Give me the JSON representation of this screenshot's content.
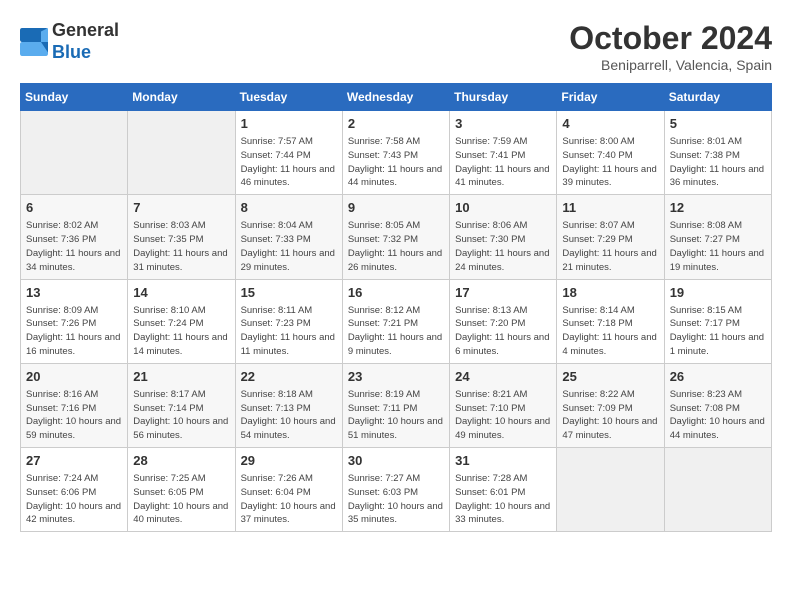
{
  "logo": {
    "text_general": "General",
    "text_blue": "Blue"
  },
  "header": {
    "month": "October 2024",
    "location": "Beniparrell, Valencia, Spain"
  },
  "days_of_week": [
    "Sunday",
    "Monday",
    "Tuesday",
    "Wednesday",
    "Thursday",
    "Friday",
    "Saturday"
  ],
  "weeks": [
    [
      {
        "day": null
      },
      {
        "day": null
      },
      {
        "day": "1",
        "sunrise": "Sunrise: 7:57 AM",
        "sunset": "Sunset: 7:44 PM",
        "daylight": "Daylight: 11 hours and 46 minutes."
      },
      {
        "day": "2",
        "sunrise": "Sunrise: 7:58 AM",
        "sunset": "Sunset: 7:43 PM",
        "daylight": "Daylight: 11 hours and 44 minutes."
      },
      {
        "day": "3",
        "sunrise": "Sunrise: 7:59 AM",
        "sunset": "Sunset: 7:41 PM",
        "daylight": "Daylight: 11 hours and 41 minutes."
      },
      {
        "day": "4",
        "sunrise": "Sunrise: 8:00 AM",
        "sunset": "Sunset: 7:40 PM",
        "daylight": "Daylight: 11 hours and 39 minutes."
      },
      {
        "day": "5",
        "sunrise": "Sunrise: 8:01 AM",
        "sunset": "Sunset: 7:38 PM",
        "daylight": "Daylight: 11 hours and 36 minutes."
      }
    ],
    [
      {
        "day": "6",
        "sunrise": "Sunrise: 8:02 AM",
        "sunset": "Sunset: 7:36 PM",
        "daylight": "Daylight: 11 hours and 34 minutes."
      },
      {
        "day": "7",
        "sunrise": "Sunrise: 8:03 AM",
        "sunset": "Sunset: 7:35 PM",
        "daylight": "Daylight: 11 hours and 31 minutes."
      },
      {
        "day": "8",
        "sunrise": "Sunrise: 8:04 AM",
        "sunset": "Sunset: 7:33 PM",
        "daylight": "Daylight: 11 hours and 29 minutes."
      },
      {
        "day": "9",
        "sunrise": "Sunrise: 8:05 AM",
        "sunset": "Sunset: 7:32 PM",
        "daylight": "Daylight: 11 hours and 26 minutes."
      },
      {
        "day": "10",
        "sunrise": "Sunrise: 8:06 AM",
        "sunset": "Sunset: 7:30 PM",
        "daylight": "Daylight: 11 hours and 24 minutes."
      },
      {
        "day": "11",
        "sunrise": "Sunrise: 8:07 AM",
        "sunset": "Sunset: 7:29 PM",
        "daylight": "Daylight: 11 hours and 21 minutes."
      },
      {
        "day": "12",
        "sunrise": "Sunrise: 8:08 AM",
        "sunset": "Sunset: 7:27 PM",
        "daylight": "Daylight: 11 hours and 19 minutes."
      }
    ],
    [
      {
        "day": "13",
        "sunrise": "Sunrise: 8:09 AM",
        "sunset": "Sunset: 7:26 PM",
        "daylight": "Daylight: 11 hours and 16 minutes."
      },
      {
        "day": "14",
        "sunrise": "Sunrise: 8:10 AM",
        "sunset": "Sunset: 7:24 PM",
        "daylight": "Daylight: 11 hours and 14 minutes."
      },
      {
        "day": "15",
        "sunrise": "Sunrise: 8:11 AM",
        "sunset": "Sunset: 7:23 PM",
        "daylight": "Daylight: 11 hours and 11 minutes."
      },
      {
        "day": "16",
        "sunrise": "Sunrise: 8:12 AM",
        "sunset": "Sunset: 7:21 PM",
        "daylight": "Daylight: 11 hours and 9 minutes."
      },
      {
        "day": "17",
        "sunrise": "Sunrise: 8:13 AM",
        "sunset": "Sunset: 7:20 PM",
        "daylight": "Daylight: 11 hours and 6 minutes."
      },
      {
        "day": "18",
        "sunrise": "Sunrise: 8:14 AM",
        "sunset": "Sunset: 7:18 PM",
        "daylight": "Daylight: 11 hours and 4 minutes."
      },
      {
        "day": "19",
        "sunrise": "Sunrise: 8:15 AM",
        "sunset": "Sunset: 7:17 PM",
        "daylight": "Daylight: 11 hours and 1 minute."
      }
    ],
    [
      {
        "day": "20",
        "sunrise": "Sunrise: 8:16 AM",
        "sunset": "Sunset: 7:16 PM",
        "daylight": "Daylight: 10 hours and 59 minutes."
      },
      {
        "day": "21",
        "sunrise": "Sunrise: 8:17 AM",
        "sunset": "Sunset: 7:14 PM",
        "daylight": "Daylight: 10 hours and 56 minutes."
      },
      {
        "day": "22",
        "sunrise": "Sunrise: 8:18 AM",
        "sunset": "Sunset: 7:13 PM",
        "daylight": "Daylight: 10 hours and 54 minutes."
      },
      {
        "day": "23",
        "sunrise": "Sunrise: 8:19 AM",
        "sunset": "Sunset: 7:11 PM",
        "daylight": "Daylight: 10 hours and 51 minutes."
      },
      {
        "day": "24",
        "sunrise": "Sunrise: 8:21 AM",
        "sunset": "Sunset: 7:10 PM",
        "daylight": "Daylight: 10 hours and 49 minutes."
      },
      {
        "day": "25",
        "sunrise": "Sunrise: 8:22 AM",
        "sunset": "Sunset: 7:09 PM",
        "daylight": "Daylight: 10 hours and 47 minutes."
      },
      {
        "day": "26",
        "sunrise": "Sunrise: 8:23 AM",
        "sunset": "Sunset: 7:08 PM",
        "daylight": "Daylight: 10 hours and 44 minutes."
      }
    ],
    [
      {
        "day": "27",
        "sunrise": "Sunrise: 7:24 AM",
        "sunset": "Sunset: 6:06 PM",
        "daylight": "Daylight: 10 hours and 42 minutes."
      },
      {
        "day": "28",
        "sunrise": "Sunrise: 7:25 AM",
        "sunset": "Sunset: 6:05 PM",
        "daylight": "Daylight: 10 hours and 40 minutes."
      },
      {
        "day": "29",
        "sunrise": "Sunrise: 7:26 AM",
        "sunset": "Sunset: 6:04 PM",
        "daylight": "Daylight: 10 hours and 37 minutes."
      },
      {
        "day": "30",
        "sunrise": "Sunrise: 7:27 AM",
        "sunset": "Sunset: 6:03 PM",
        "daylight": "Daylight: 10 hours and 35 minutes."
      },
      {
        "day": "31",
        "sunrise": "Sunrise: 7:28 AM",
        "sunset": "Sunset: 6:01 PM",
        "daylight": "Daylight: 10 hours and 33 minutes."
      },
      {
        "day": null
      },
      {
        "day": null
      }
    ]
  ]
}
